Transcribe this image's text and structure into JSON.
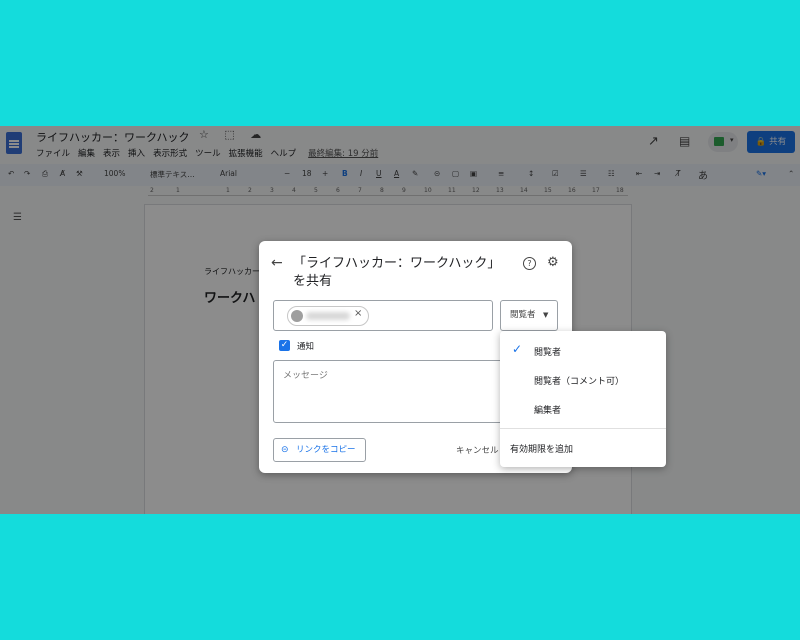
{
  "app": {
    "doc_title": "ライフハッカー：ワークハック",
    "title_icons": "☆ ⬚ ☁",
    "menus": [
      "ファイル",
      "編集",
      "表示",
      "挿入",
      "表示形式",
      "ツール",
      "拡張機能",
      "ヘルプ"
    ],
    "last_edit": "最終編集: 19 分前",
    "share_label": "🔒 共有",
    "icons": [
      "trending-up-icon",
      "comment-icon",
      "meet-icon",
      "lock-icon"
    ]
  },
  "toolbar": {
    "zoom": "100%",
    "style": "標準テキス…",
    "font": "Arial",
    "minus": "−",
    "size": "18",
    "plus": "+",
    "bold": "B",
    "italic": "I",
    "underline": "U",
    "text_color": "A",
    "input_mode": "あ"
  },
  "ruler": {
    "ticks": [
      "2",
      "1",
      "1",
      "2",
      "3",
      "4",
      "5",
      "6",
      "7",
      "8",
      "9",
      "10",
      "11",
      "12",
      "13",
      "14",
      "15",
      "16",
      "17",
      "18"
    ]
  },
  "document": {
    "small_text": "ライフハッカー",
    "heading": "ワークハ"
  },
  "dialog": {
    "title": "「ライフハッカー：ワークハック」を共有",
    "role_label": "閲覧者",
    "notify_label": "通知",
    "message_placeholder": "メッセージ",
    "copy_link": "リンクをコピー",
    "cancel": "キャンセル"
  },
  "role_menu": {
    "items": [
      "閲覧者",
      "閲覧者（コメント可）",
      "編集者"
    ],
    "selected_index": 0,
    "extra": "有効期限を追加"
  },
  "colors": {
    "background": "#14dcdc",
    "accent": "#1a73e8"
  }
}
